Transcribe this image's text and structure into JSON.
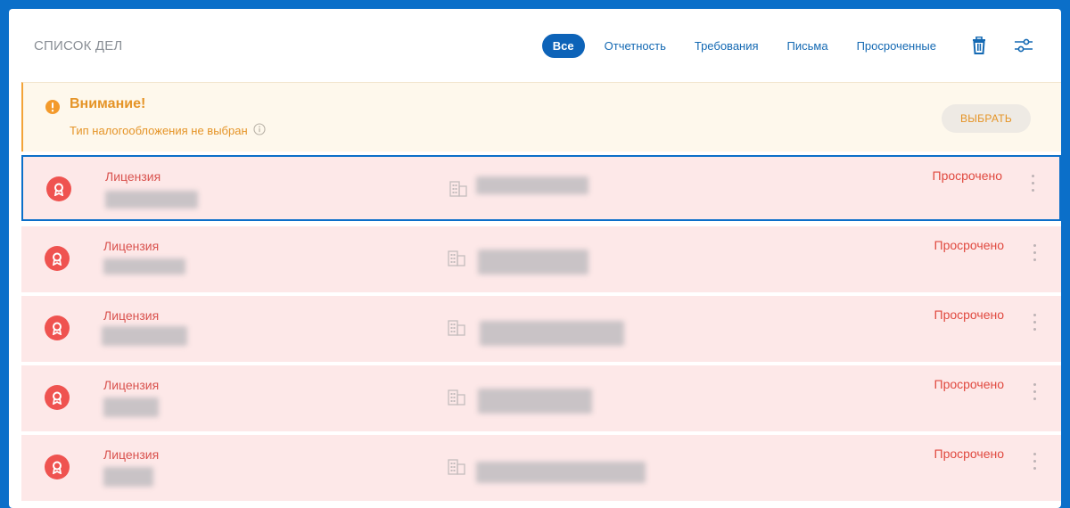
{
  "header": {
    "title": "СПИСОК ДЕЛ",
    "filters": [
      {
        "label": "Все",
        "active": true
      },
      {
        "label": "Отчетность",
        "active": false
      },
      {
        "label": "Требования",
        "active": false
      },
      {
        "label": "Письма",
        "active": false
      },
      {
        "label": "Просроченные",
        "active": false
      }
    ],
    "icons": [
      "trash-icon",
      "filter-settings-icon"
    ]
  },
  "alert": {
    "title": "Внимание!",
    "subtitle": "Тип налогообложения не выбран",
    "button_label": "ВЫБРАТЬ",
    "icon": "warning-icon",
    "info_icon": "info-icon"
  },
  "tasks": [
    {
      "type": "Лицензия",
      "status": "Просрочено",
      "selected": true
    },
    {
      "type": "Лицензия",
      "status": "Просрочено",
      "selected": false
    },
    {
      "type": "Лицензия",
      "status": "Просрочено",
      "selected": false
    },
    {
      "type": "Лицензия",
      "status": "Просрочено",
      "selected": false
    },
    {
      "type": "Лицензия",
      "status": "Просрочено",
      "selected": false
    }
  ],
  "colors": {
    "accent": "#0d63b8",
    "warning": "#e59427",
    "danger": "#e0493f",
    "row_background": "#fde8e8",
    "frame": "#0b6fc9"
  }
}
